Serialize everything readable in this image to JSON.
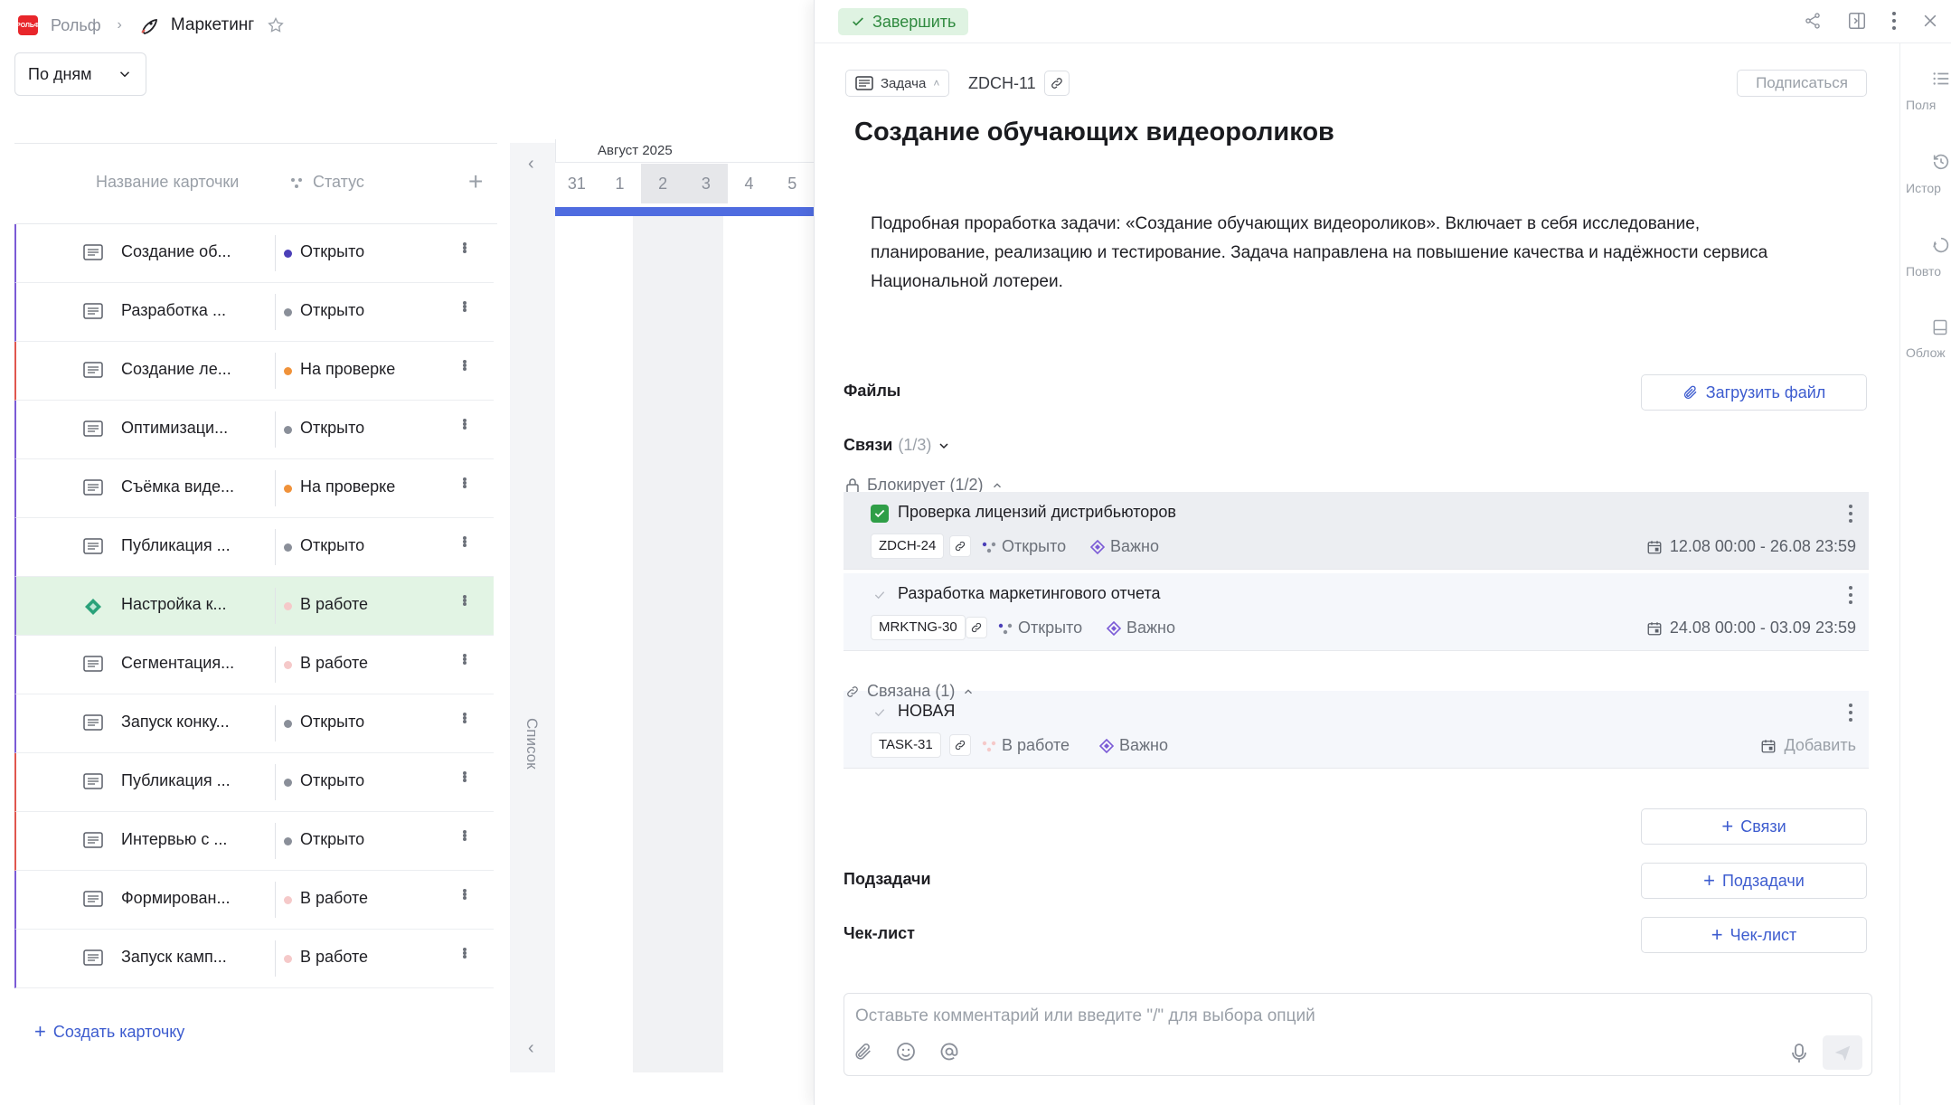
{
  "breadcrumbs": {
    "workspace": "Рольф",
    "project": "Маркетинг"
  },
  "view_select": {
    "value": "По дням"
  },
  "list": {
    "col_name": "Название карточки",
    "col_status": "Статус",
    "rows": [
      {
        "name": "Создание об...",
        "status": "Открыто",
        "dot": "#4b3fb8",
        "accent": "#7b5bd6",
        "selected": false,
        "icon": "card-icon"
      },
      {
        "name": "Разработка ...",
        "status": "Открыто",
        "dot": "#8a8f99",
        "accent": "#7b5bd6",
        "selected": false,
        "icon": "card-icon"
      },
      {
        "name": "Создание ле...",
        "status": "На проверке",
        "dot": "#f0923a",
        "accent": "#e0564e",
        "selected": false,
        "icon": "card-icon"
      },
      {
        "name": "Оптимизаци...",
        "status": "Открыто",
        "dot": "#8a8f99",
        "accent": "#7b5bd6",
        "selected": false,
        "icon": "card-icon"
      },
      {
        "name": "Съёмка виде...",
        "status": "На проверке",
        "dot": "#f0923a",
        "accent": "#7b5bd6",
        "selected": false,
        "icon": "card-icon"
      },
      {
        "name": "Публикация ...",
        "status": "Открыто",
        "dot": "#8a8f99",
        "accent": "#7b5bd6",
        "selected": false,
        "icon": "card-icon"
      },
      {
        "name": "Настройка к...",
        "status": "В работе",
        "dot": "#f5c9c9",
        "accent": "#7b5bd6",
        "selected": true,
        "icon": "diamond-icon"
      },
      {
        "name": "Сегментация...",
        "status": "В работе",
        "dot": "#f5c9c9",
        "accent": "#7b5bd6",
        "selected": false,
        "icon": "card-icon"
      },
      {
        "name": "Запуск конку...",
        "status": "Открыто",
        "dot": "#8a8f99",
        "accent": "#7b5bd6",
        "selected": false,
        "icon": "card-icon"
      },
      {
        "name": "Публикация ...",
        "status": "Открыто",
        "dot": "#8a8f99",
        "accent": "#e0564e",
        "selected": false,
        "icon": "card-icon"
      },
      {
        "name": "Интервью с ...",
        "status": "Открыто",
        "dot": "#8a8f99",
        "accent": "#e0564e",
        "selected": false,
        "icon": "card-icon"
      },
      {
        "name": "Формирован...",
        "status": "В работе",
        "dot": "#f5c9c9",
        "accent": "#7b5bd6",
        "selected": false,
        "icon": "card-icon"
      },
      {
        "name": "Запуск камп...",
        "status": "В работе",
        "dot": "#f5c9c9",
        "accent": "#7b5bd6",
        "selected": false,
        "icon": "card-icon"
      }
    ],
    "create_label": "Создать карточку"
  },
  "side_strip": {
    "label": "Список"
  },
  "gantt": {
    "month": "Август 2025",
    "days": [
      {
        "d": "31",
        "weekend": false
      },
      {
        "d": "1",
        "weekend": false
      },
      {
        "d": "2",
        "weekend": true
      },
      {
        "d": "3",
        "weekend": true
      },
      {
        "d": "4",
        "weekend": false
      },
      {
        "d": "5",
        "weekend": false
      }
    ]
  },
  "panel": {
    "finish_label": "Завершить",
    "type_label": "Задача",
    "task_id": "ZDCH-11",
    "subscribe_label": "Подписаться",
    "title": "Создание обучающих видеороликов",
    "description": "Подробная проработка задачи: «Создание обучающих видеороликов». Включает в себя исследование, планирование, реализацию и тестирование. Задача направлена на повышение качества и надёжности сервиса Национальной лотереи.",
    "files_label": "Файлы",
    "upload_label": "Загрузить файл",
    "links_label": "Связи",
    "links_count": "(1/3)",
    "blocks_label": "Блокирует (1/2)",
    "related_label": "Связана (1)",
    "links_add_label": "Связи",
    "subtasks_label": "Подзадачи",
    "subtasks_add_label": "Подзадачи",
    "checklist_label": "Чек-лист",
    "checklist_add_label": "Чек-лист",
    "comment_placeholder": "Оставьте комментарий или введите \"/\" для выбора опций"
  },
  "linked": [
    {
      "title": "Проверка лицензий дистрибьюторов",
      "id": "ZDCH-24",
      "status": "Открыто",
      "priority": "Важно",
      "date": "12.08 00:00 - 26.08 23:59",
      "done": true
    },
    {
      "title": "Разработка маркетингового отчета",
      "id": "MRKTNG-30",
      "status": "Открыто",
      "priority": "Важно",
      "date": "24.08 00:00 - 03.09 23:59",
      "done": false
    },
    {
      "title": "НОВАЯ",
      "id": "TASK-31",
      "status": "В работе",
      "priority": "Важно",
      "date": "Добавить",
      "done": false
    }
  ],
  "rail": [
    {
      "label": "Поля",
      "icon": "list-icon"
    },
    {
      "label": "Истор",
      "icon": "history-icon"
    },
    {
      "label": "Повто",
      "icon": "repeat-icon"
    },
    {
      "label": "Облож",
      "icon": "cover-icon"
    }
  ],
  "colors": {
    "accent_blue": "#3d5ccf",
    "success_bg": "#dff3e2",
    "success_fg": "#2f8a3f",
    "gantt_bar": "#4f6ce0"
  }
}
